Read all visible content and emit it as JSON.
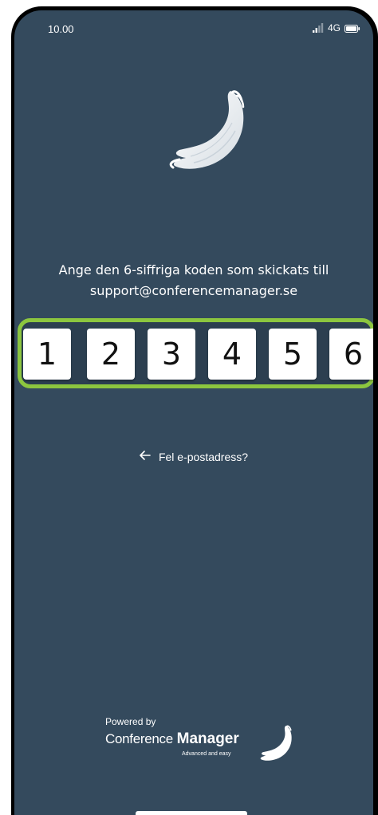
{
  "status_bar": {
    "time": "10.00",
    "network": "4G",
    "icons": [
      "signal-icon",
      "battery-icon"
    ]
  },
  "logo": {
    "icon": "conference-manager-swoosh-icon"
  },
  "prompt": {
    "line1": "Ange den 6-siffriga koden som skickats till",
    "line2": "support@conferencemanager.se"
  },
  "code": {
    "digits": [
      "1",
      "2",
      "3",
      "4",
      "5",
      "6"
    ],
    "highlight_color": "#8cc63f"
  },
  "back_link": {
    "icon": "arrow-left-icon",
    "label": "Fel e-postadress?"
  },
  "footer": {
    "powered_by": "Powered by",
    "brand_part1": "Conference",
    "brand_part2": "Manager",
    "tagline": "Advanced and easy",
    "icon": "conference-manager-swoosh-icon"
  },
  "colors": {
    "background": "#344a5d",
    "text": "#ffffff",
    "accent": "#8cc63f"
  }
}
